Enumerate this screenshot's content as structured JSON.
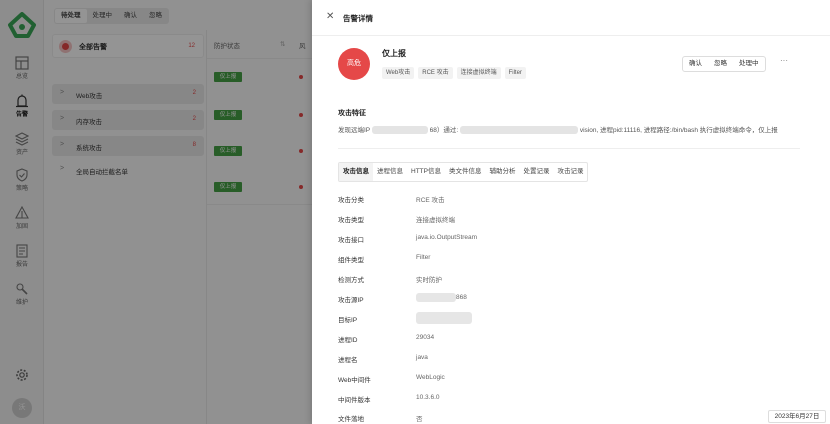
{
  "nav": {
    "items": [
      {
        "label": "总览",
        "icon": "dashboard-icon"
      },
      {
        "label": "告警",
        "icon": "alert-icon"
      },
      {
        "label": "资产",
        "icon": "asset-icon"
      },
      {
        "label": "策略",
        "icon": "shield-icon"
      },
      {
        "label": "加固",
        "icon": "reinforce-icon"
      },
      {
        "label": "报告",
        "icon": "report-icon"
      },
      {
        "label": "维护",
        "icon": "wrench-icon"
      }
    ],
    "active": "告警",
    "settings_icon": "gear-icon",
    "avatar_text": "沃"
  },
  "list": {
    "tabs": [
      "待处理",
      "处理中",
      "确认",
      "忽略"
    ],
    "active_tab": "待处理",
    "group": {
      "title": "全部告警",
      "count": "12"
    },
    "categories": [
      {
        "name": "Web攻击",
        "count": "2"
      },
      {
        "name": "内存攻击",
        "count": "2"
      },
      {
        "name": "系统攻击",
        "count": "8"
      },
      {
        "name": "全局自动拦截名单",
        "count": ""
      }
    ],
    "columns": [
      "防护状态",
      "风"
    ],
    "row_status": "仅上报"
  },
  "drawer": {
    "title": "告警详情",
    "severity": "高危",
    "alert_name": "仅上报",
    "tags": [
      "Web攻击",
      "RCE 攻击",
      "连接虚拟终端",
      "Filter"
    ],
    "actions": [
      "确认",
      "忽略",
      "处理中"
    ],
    "more": "···",
    "feature_title": "攻击特征",
    "feature_prefix": "发现远端IP",
    "feature_mid1": "68）通过:",
    "feature_suffix": "vision, 进程pid:11116, 进程路径:/bin/bash 执行虚拟终端命令，仅上报",
    "detail_tabs": [
      "攻击信息",
      "进程信息",
      "HTTP信息",
      "类文件信息",
      "辅助分析",
      "处置记录",
      "攻击记录"
    ],
    "active_detail_tab": "攻击信息",
    "fields": [
      {
        "key": "攻击分类",
        "value": "RCE 攻击"
      },
      {
        "key": "攻击类型",
        "value": "连接虚拟终端"
      },
      {
        "key": "攻击接口",
        "value": "java.io.OutputStream"
      },
      {
        "key": "组件类型",
        "value": "Filter"
      },
      {
        "key": "检测方式",
        "value": "实时防护"
      },
      {
        "key": "攻击源IP",
        "value": "868"
      },
      {
        "key": "目标IP",
        "value": ""
      },
      {
        "key": "进程ID",
        "value": "29034"
      },
      {
        "key": "进程名",
        "value": "java"
      },
      {
        "key": "Web中间件",
        "value": "WebLogic"
      },
      {
        "key": "中间件版本",
        "value": "10.3.6.0"
      },
      {
        "key": "文件落地",
        "value": "否"
      }
    ]
  },
  "date_badge": "2023年6月27日"
}
